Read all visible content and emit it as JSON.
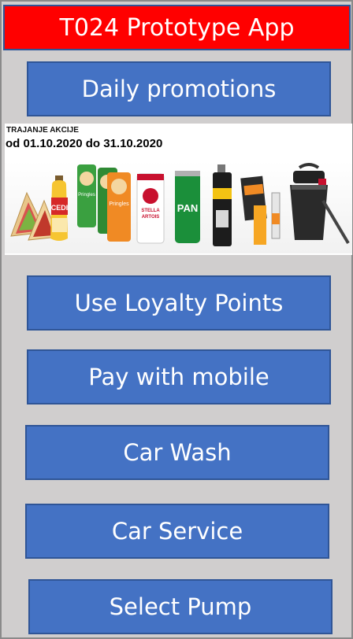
{
  "app": {
    "title": "T024 Prototype App"
  },
  "buttons": {
    "promotions": "Daily promotions",
    "loyalty": "Use Loyalty Points",
    "pay": "Pay with mobile",
    "wash": "Car Wash",
    "service": "Car Service",
    "pump": "Select Pump"
  },
  "banner": {
    "caption": "TRAJANJE AKCIJE",
    "dates": "od 01.10.2020 do 31.10.2020",
    "product_labels": {
      "cedi": "CEDI",
      "pringles": "Pringles",
      "stella": "STELLA ARTOIS",
      "pan": "PAN",
      "gorilla": "GORILLA"
    }
  },
  "colors": {
    "title_bg": "#ff0000",
    "button_bg": "#4472c4",
    "button_border": "#2f5597",
    "background": "#d0cece"
  }
}
